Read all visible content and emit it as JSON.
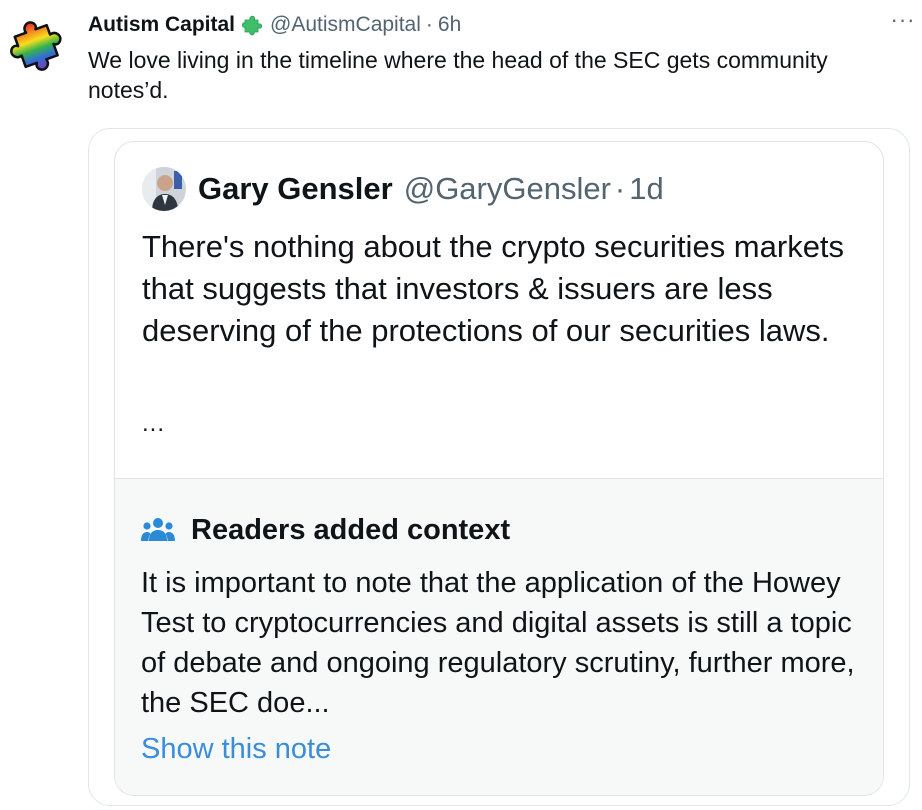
{
  "author": {
    "name": "Autism Capital",
    "handle": "@AutismCapital",
    "separator": "·",
    "time": "6h",
    "badge_icon": "puzzle-piece-icon",
    "avatar_icon": "rainbow-puzzle-icon"
  },
  "more_icon": "more-options-icon",
  "more_label": "···",
  "text": "We love living in the timeline where the head of the SEC gets community notes’d.",
  "quoted": {
    "name": "Gary Gensler",
    "handle": "@GaryGensler",
    "separator": "·",
    "time": "1d",
    "text": "There's nothing about the crypto securities markets that suggests that investors & issuers are less deserving of the protections of our securities laws.",
    "ellipsis": "...",
    "avatar_icon": "profile-photo"
  },
  "context": {
    "icon": "people-icon",
    "title": "Readers added context",
    "text": "It is important to note that the application of the Howey Test to cryptocurrencies and digital assets is still a topic of debate and ongoing regulatory scrutiny, further more, the SEC doe...",
    "link": "Show this note"
  },
  "colors": {
    "text_primary": "#0f1419",
    "text_secondary": "#536471",
    "link": "#3a8dd9",
    "context_bg": "#f7f9f9",
    "badge_green": "#3fbf6a"
  }
}
